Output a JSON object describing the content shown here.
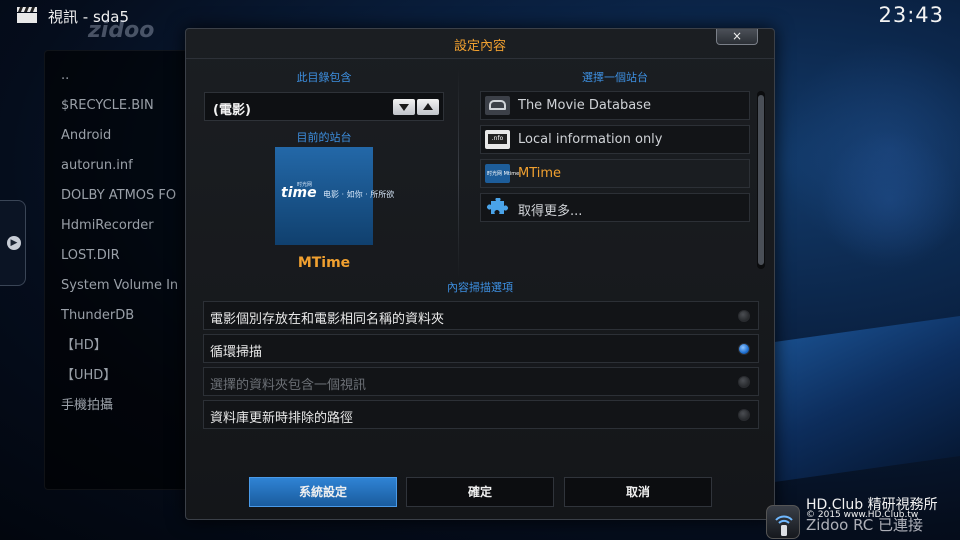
{
  "topbar": {
    "title": "視訊 - sda5",
    "clock": "23:43"
  },
  "background_logo": "zidoo",
  "file_list": [
    "..",
    "$RECYCLE.BIN",
    "Android",
    "autorun.inf",
    "DOLBY ATMOS FO",
    "HdmiRecorder",
    "LOST.DIR",
    "System Volume In",
    "ThunderDB",
    "【HD】",
    "【UHD】",
    "手機拍攝"
  ],
  "dialog": {
    "title": "設定內容",
    "close_label": "×",
    "content_section": {
      "label": "此目錄包含",
      "value": "(電影)"
    },
    "current_site": {
      "label": "目前的站台",
      "logo_text": "time",
      "logo_sub": "电影 · 如你 · 所所欲",
      "logo_top": "时光网",
      "name": "MTime"
    },
    "site_section_label": "選擇一個站台",
    "sites": [
      {
        "label": "The Movie Database",
        "icon": "tmdb-icon",
        "selected": false
      },
      {
        "label": "Local information only",
        "icon": "nfo-icon",
        "icon_text": ".nfo",
        "selected": false
      },
      {
        "label": "MTime",
        "icon": "mtime-icon",
        "icon_text": "时光网 Mtime",
        "selected": true
      },
      {
        "label": "取得更多...",
        "icon": "puzzle-icon",
        "selected": false
      }
    ],
    "scan_section_label": "內容掃描選項",
    "options": [
      {
        "label": "電影個別存放在和電影相同名稱的資料夾",
        "on": false,
        "enabled": true
      },
      {
        "label": "循環掃描",
        "on": true,
        "enabled": true
      },
      {
        "label": "選擇的資料夾包含一個視訊",
        "on": false,
        "enabled": false
      },
      {
        "label": "資料庫更新時排除的路徑",
        "on": false,
        "enabled": true
      }
    ],
    "buttons": {
      "settings": "系統設定",
      "ok": "確定",
      "cancel": "取消"
    }
  },
  "watermark": {
    "line1": "HD.Club 精研視務所",
    "line2": "© 2015  www.HD.Club.tw",
    "remote_status": "Zidoo RC 已連接"
  },
  "colors": {
    "accent": "#f0a030",
    "section_label": "#3d8fe0",
    "focus": "#2f83d4"
  }
}
